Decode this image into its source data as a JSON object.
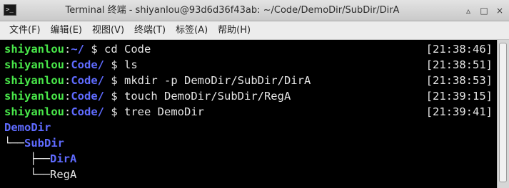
{
  "window": {
    "title": "Terminal 终端 - shiyanlou@93d6d36f43ab: ~/Code/DemoDir/SubDir/DirA",
    "icon_text": ">_",
    "controls": {
      "minimize": "▵",
      "maximize": "□",
      "close": "×"
    }
  },
  "menu": [
    {
      "label": "文件(F)"
    },
    {
      "label": "编辑(E)"
    },
    {
      "label": "视图(V)"
    },
    {
      "label": "终端(T)"
    },
    {
      "label": "标签(A)"
    },
    {
      "label": "帮助(H)"
    }
  ],
  "terminal": {
    "prompt_user": "shiyanlou",
    "prompt_sep": ":",
    "lines": [
      {
        "path": "~/",
        "command": " $ cd Code",
        "time": "[21:38:46]"
      },
      {
        "path": "Code/",
        "command": " $ ls",
        "time": "[21:38:51]"
      },
      {
        "path": "Code/",
        "command": " $ mkdir -p DemoDir/SubDir/DirA",
        "time": "[21:38:53]"
      },
      {
        "path": "Code/",
        "command": " $ touch DemoDir/SubDir/RegA",
        "time": "[21:39:15]"
      },
      {
        "path": "Code/",
        "command": " $ tree DemoDir",
        "time": "[21:39:41]"
      }
    ],
    "tree": {
      "root": "DemoDir",
      "sub_prefix": "└──",
      "sub": "SubDir",
      "dir_prefix": "├──",
      "dir": "DirA",
      "file_prefix": "└──",
      "file": "RegA"
    }
  },
  "colors": {
    "user": "#49e84a",
    "path": "#5f6bff",
    "text": "#e5e5e5",
    "background": "#000000"
  }
}
